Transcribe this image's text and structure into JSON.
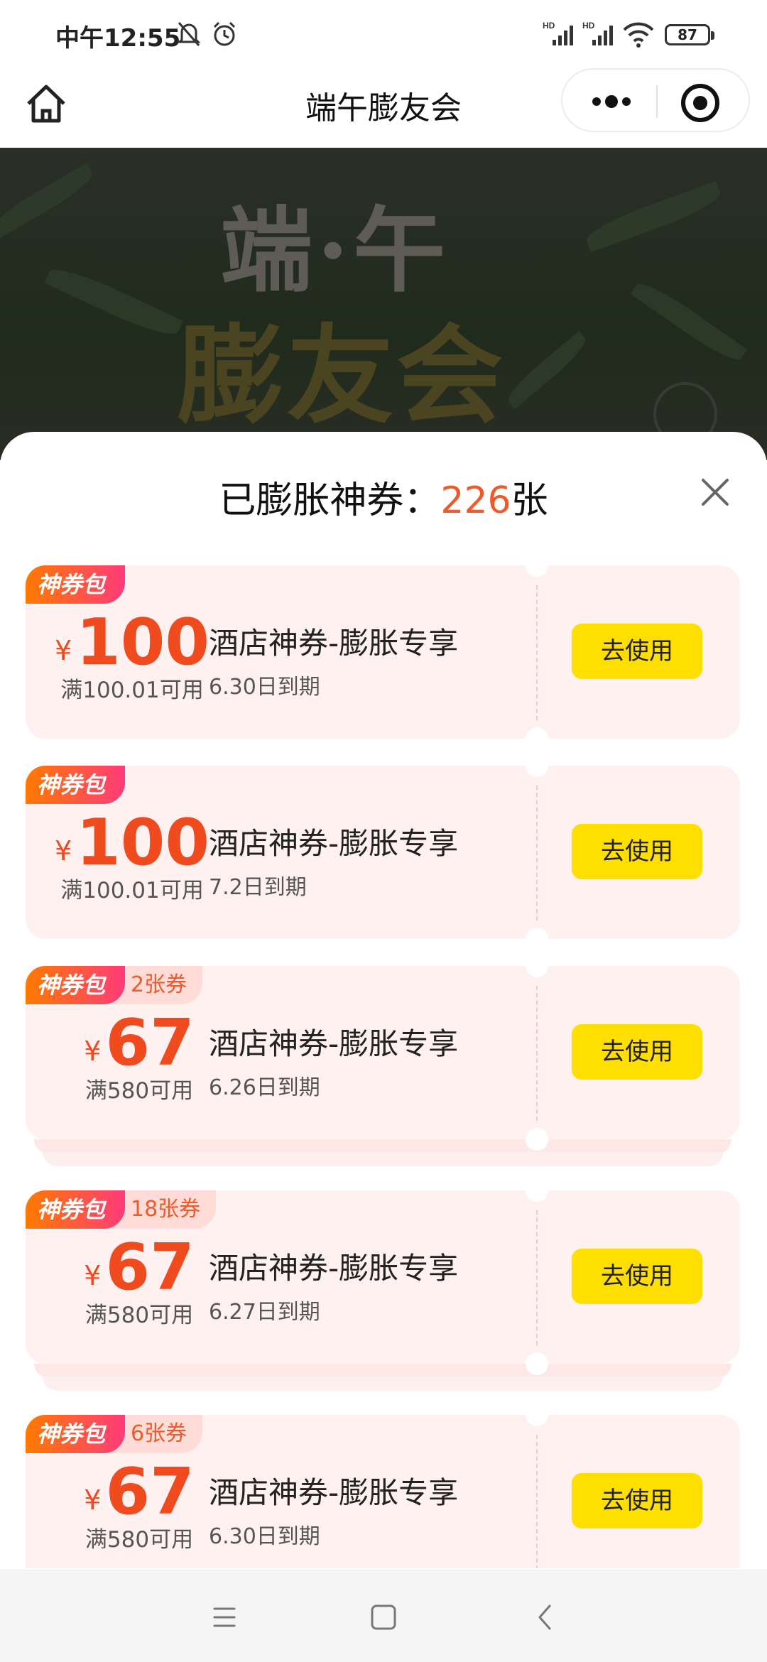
{
  "status_bar": {
    "time": "中午12:55",
    "battery": "87",
    "icons": [
      "mute-bell-icon",
      "alarm-icon",
      "hd-signal-icon",
      "hd-signal-icon",
      "wifi-icon"
    ]
  },
  "nav": {
    "title": "端午膨友会",
    "icons": [
      "home-icon",
      "more-dots-icon",
      "close-target-icon"
    ]
  },
  "banner": {
    "line1": "端·午",
    "line2": "膨友会"
  },
  "sheet": {
    "header_prefix": "已膨胀神券：",
    "count": "226",
    "header_suffix": "张"
  },
  "coupons": [
    {
      "tag": "神券包",
      "subtag": "",
      "yen": "¥",
      "amount": "100",
      "condition": "满100.01可用",
      "title": "酒店神券-膨胀专享",
      "expire": "6.30日到期",
      "button": "去使用"
    },
    {
      "tag": "神券包",
      "subtag": "",
      "yen": "¥",
      "amount": "100",
      "condition": "满100.01可用",
      "title": "酒店神券-膨胀专享",
      "expire": "7.2日到期",
      "button": "去使用"
    },
    {
      "tag": "神券包",
      "subtag": "2张券",
      "yen": "¥",
      "amount": "67",
      "condition": "满580可用",
      "title": "酒店神券-膨胀专享",
      "expire": "6.26日到期",
      "button": "去使用"
    },
    {
      "tag": "神券包",
      "subtag": "18张券",
      "yen": "¥",
      "amount": "67",
      "condition": "满580可用",
      "title": "酒店神券-膨胀专享",
      "expire": "6.27日到期",
      "button": "去使用"
    },
    {
      "tag": "神券包",
      "subtag": "6张券",
      "yen": "¥",
      "amount": "67",
      "condition": "满580可用",
      "title": "酒店神券-膨胀专享",
      "expire": "6.30日到期",
      "button": "去使用"
    }
  ],
  "system_nav": [
    "menu-icon",
    "home-square-icon",
    "back-icon"
  ],
  "colors": {
    "accent": "#f05a2a",
    "button": "#ffdf00",
    "coupon_bg": "#fff1f0"
  }
}
